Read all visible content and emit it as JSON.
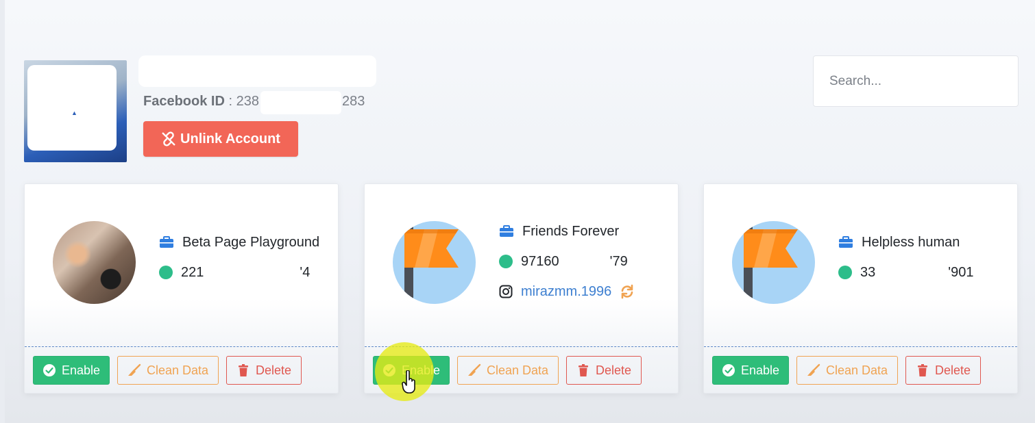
{
  "account": {
    "facebook_id_label": "Facebook ID",
    "facebook_id_separator": " : ",
    "facebook_id_prefix": "238",
    "facebook_id_suffix": "283",
    "unlink_label": "Unlink Account"
  },
  "search": {
    "placeholder": "Search..."
  },
  "pages": [
    {
      "name": "Beta Page Playground",
      "id_prefix": "221",
      "id_suffix": "'4",
      "enable_label": "Enable",
      "clean_label": "Clean Data",
      "delete_label": "Delete"
    },
    {
      "name": "Friends Forever",
      "id_prefix": "97160",
      "id_suffix": "'79",
      "instagram": "mirazmm.1996",
      "enable_label": "Enable",
      "clean_label": "Clean Data",
      "delete_label": "Delete"
    },
    {
      "name": "Helpless human",
      "id_prefix": "33",
      "id_suffix": "'901",
      "enable_label": "Enable",
      "clean_label": "Clean Data",
      "delete_label": "Delete"
    }
  ],
  "colors": {
    "unlink": "#f26657",
    "enable": "#2ebd79",
    "clean": "#f0a352",
    "delete": "#e0574f",
    "status_dot": "#2dbd8a",
    "link": "#3d7fd0"
  },
  "icons": {
    "unlink": "unlink-icon",
    "briefcase": "briefcase-icon",
    "instagram": "instagram-icon",
    "sync": "sync-icon",
    "check": "check-circle-icon",
    "broom": "broom-icon",
    "trash": "trash-icon"
  }
}
